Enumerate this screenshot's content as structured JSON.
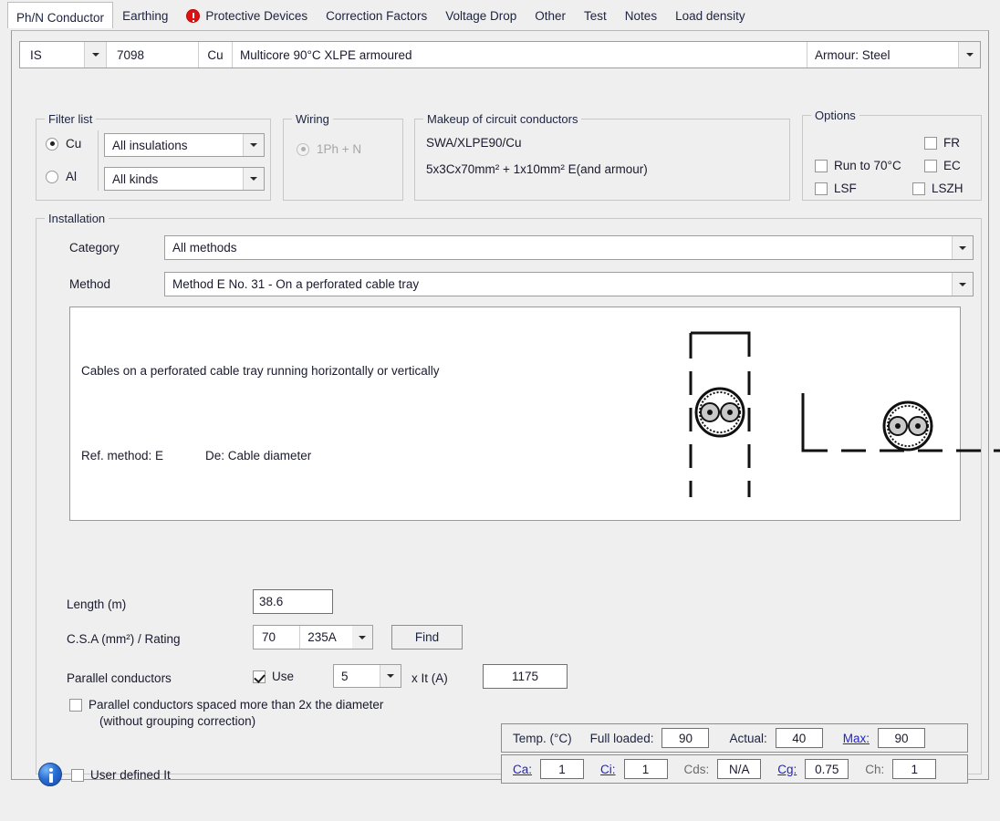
{
  "tabs": [
    {
      "label": "Ph/N Conductor",
      "active": true,
      "icon": null
    },
    {
      "label": "Earthing",
      "active": false,
      "icon": null
    },
    {
      "label": "Protective Devices",
      "active": false,
      "icon": "error-icon"
    },
    {
      "label": "Correction Factors",
      "active": false,
      "icon": null
    },
    {
      "label": "Voltage Drop",
      "active": false,
      "icon": null
    },
    {
      "label": "Other",
      "active": false,
      "icon": null
    },
    {
      "label": "Test",
      "active": false,
      "icon": null
    },
    {
      "label": "Notes",
      "active": false,
      "icon": null
    },
    {
      "label": "Load density",
      "active": false,
      "icon": null
    }
  ],
  "cable_row": {
    "standard": "IS",
    "cable_id": "7098",
    "material": "Cu",
    "description": "Multicore 90°C XLPE armoured",
    "armour": "Armour: Steel"
  },
  "filter_list": {
    "legend": "Filter list",
    "cu_label": "Cu",
    "cu_selected": true,
    "al_label": "Al",
    "al_selected": false,
    "insulation": "All insulations",
    "kinds": "All kinds"
  },
  "wiring": {
    "legend": "Wiring",
    "option": "1Ph + N",
    "selected": true,
    "disabled": true
  },
  "makeup": {
    "legend": "Makeup of circuit conductors",
    "line1": "SWA/XLPE90/Cu",
    "line2": "5x3Cx70mm² + 1x10mm² E(and armour)"
  },
  "options": {
    "legend": "Options",
    "items": [
      {
        "label": "FR",
        "checked": false
      },
      {
        "label": "Run to 70°C",
        "checked": false
      },
      {
        "label": "EC",
        "checked": false
      },
      {
        "label": "LSF",
        "checked": false
      },
      {
        "label": "LSZH",
        "checked": false
      }
    ]
  },
  "installation": {
    "legend": "Installation",
    "category_label": "Category",
    "category_value": "All methods",
    "method_label": "Method",
    "method_value": "Method E No. 31     -     On a perforated cable tray",
    "illustration": {
      "description": "Cables on a perforated cable tray running horizontally or vertically",
      "ref_method": "Ref. method: E",
      "de": "De: Cable diameter"
    },
    "length_label": "Length (m)",
    "length_value": "38.6",
    "csa_label": "C.S.A (mm²) / Rating",
    "csa_value": "70",
    "rating_value": "235A",
    "find_button": "Find",
    "parallel_label": "Parallel conductors",
    "use_label": "Use",
    "use_checked": true,
    "parallel_count": "5",
    "xit_label": "x It (A)",
    "xit_value": "1175",
    "spaced_label_line1": "Parallel conductors spaced more than 2x the diameter",
    "spaced_label_line2": "(without grouping correction)",
    "spaced_checked": false,
    "user_defined_label": "User defined It",
    "user_defined_checked": false
  },
  "temperature": {
    "title": "Temp. (°C)",
    "full_loaded_label": "Full loaded:",
    "full_loaded_value": "90",
    "actual_label": "Actual:",
    "actual_value": "40",
    "max_label": "Max:",
    "max_value": "90"
  },
  "factors": {
    "ca_label": "Ca:",
    "ca_value": "1",
    "ci_label": "Ci:",
    "ci_value": "1",
    "cds_label": "Cds:",
    "cds_value": "N/A",
    "cg_label": "Cg:",
    "cg_value": "0.75",
    "ch_label": "Ch:",
    "ch_value": "1"
  },
  "colors": {
    "link": "#2222CC",
    "error": "#DD1111",
    "panel_bg": "#EFEFEF",
    "field_bg": "#FFFFFF"
  }
}
